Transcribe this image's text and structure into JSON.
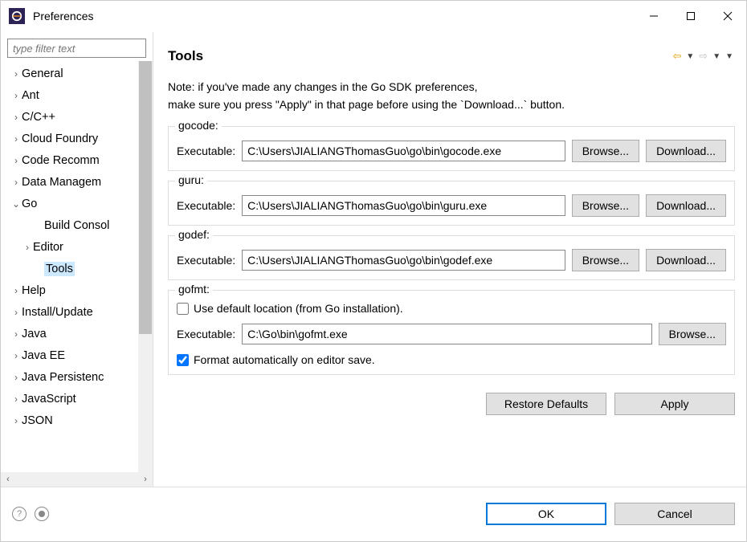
{
  "window": {
    "title": "Preferences"
  },
  "sidebar": {
    "filter_placeholder": "type filter text",
    "items": [
      {
        "label": "General"
      },
      {
        "label": "Ant"
      },
      {
        "label": "C/C++"
      },
      {
        "label": "Cloud Foundry"
      },
      {
        "label": "Code Recomm"
      },
      {
        "label": "Data Managem"
      },
      {
        "label": "Go"
      },
      {
        "label": "Build Consol"
      },
      {
        "label": "Editor"
      },
      {
        "label": "Tools"
      },
      {
        "label": "Help"
      },
      {
        "label": "Install/Update"
      },
      {
        "label": "Java"
      },
      {
        "label": "Java EE"
      },
      {
        "label": "Java Persistenc"
      },
      {
        "label": "JavaScript"
      },
      {
        "label": "JSON"
      }
    ]
  },
  "main": {
    "heading": "Tools",
    "note_line1": "Note: if you've made any changes in the Go SDK preferences,",
    "note_line2": "make sure you press \"Apply\" in that page before using the `Download...` button.",
    "executable_label": "Executable:",
    "browse_label": "Browse...",
    "download_label": "Download...",
    "restore_label": "Restore Defaults",
    "apply_label": "Apply",
    "tools": {
      "gocode": {
        "title": "gocode:",
        "path": "C:\\Users\\JIALIANGThomasGuo\\go\\bin\\gocode.exe"
      },
      "guru": {
        "title": "guru:",
        "path": "C:\\Users\\JIALIANGThomasGuo\\go\\bin\\guru.exe"
      },
      "godef": {
        "title": "godef:",
        "path": "C:\\Users\\JIALIANGThomasGuo\\go\\bin\\godef.exe"
      },
      "gofmt": {
        "title": "gofmt:",
        "use_default_label": "Use default location (from Go installation).",
        "path": "C:\\Go\\bin\\gofmt.exe",
        "format_on_save_label": "Format automatically on editor save."
      }
    }
  },
  "footer": {
    "ok_label": "OK",
    "cancel_label": "Cancel"
  }
}
